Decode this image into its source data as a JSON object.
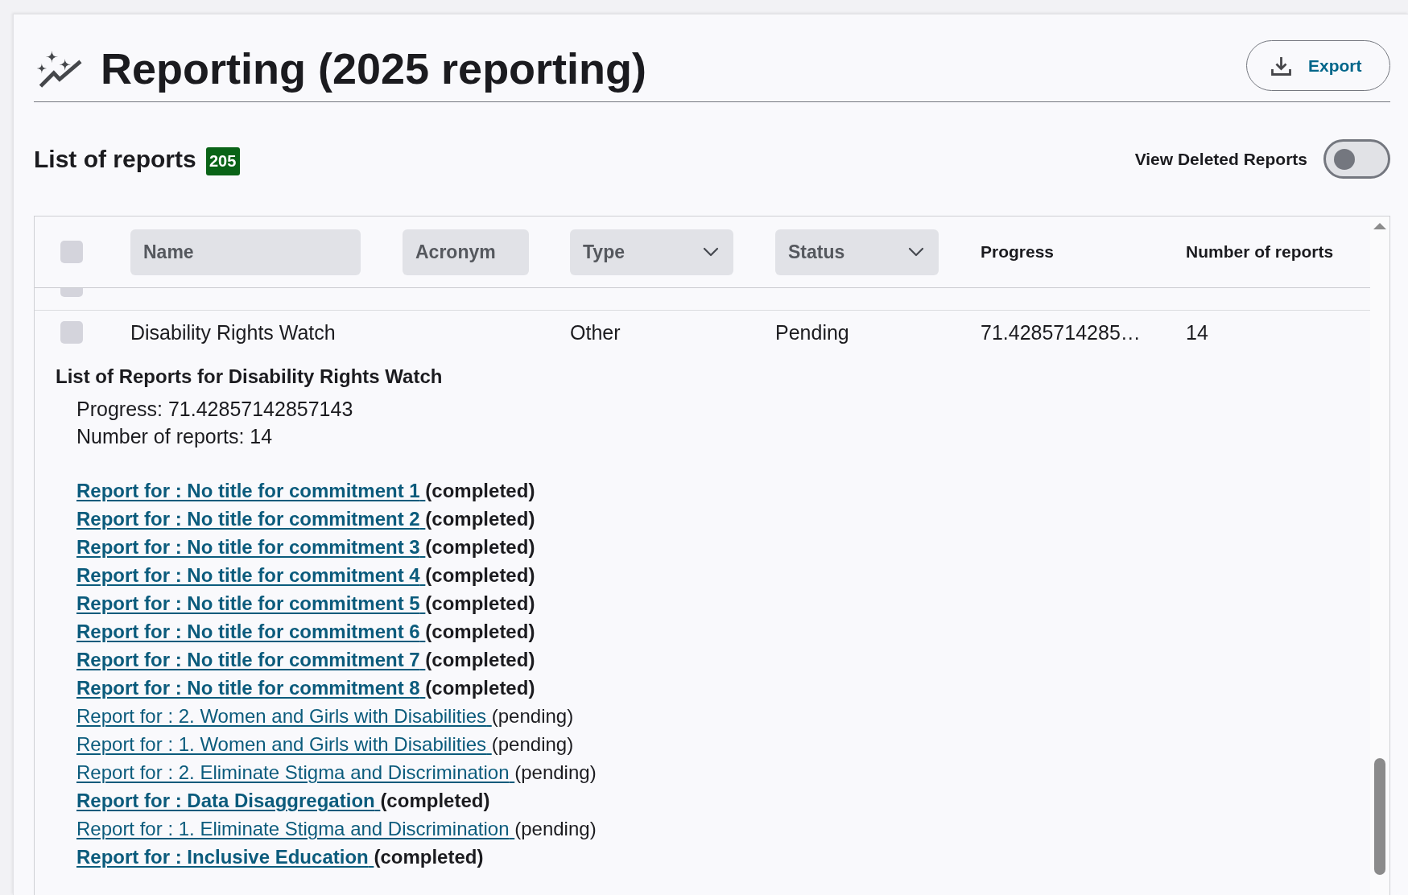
{
  "page": {
    "title": "Reporting (2025 reporting)",
    "export_button": "Export"
  },
  "list_header": {
    "title": "List of reports",
    "count": "205",
    "toggle": {
      "label": "View Deleted Reports",
      "on": false
    }
  },
  "table": {
    "select_all": {
      "checked": false
    },
    "columns": [
      {
        "kind": "text",
        "placeholder": "Name"
      },
      {
        "kind": "text",
        "placeholder": "Acronym"
      },
      {
        "kind": "select",
        "label": "Type"
      },
      {
        "kind": "select",
        "label": "Status"
      },
      {
        "kind": "plain",
        "label": "Progress"
      },
      {
        "kind": "plain",
        "label": "Number of reports"
      }
    ],
    "rows": [
      {
        "checked": false,
        "partly_hidden": true,
        "expanded": false
      },
      {
        "checked": false,
        "partly_hidden": false,
        "expanded": true,
        "name": "Disability Rights Watch",
        "type": "Other",
        "status": "Pending",
        "progress": "71.4285714285…",
        "number_of_reports": "14",
        "details": {
          "title": "List of Reports for Disability Rights Watch",
          "progress": "Progress: 71.42857142857143",
          "count": "Number of reports: 14",
          "reports": [
            {
              "link": "Report for : No title for commitment 1",
              "status": "(completed)",
              "completed": true
            },
            {
              "link": "Report for : No title for commitment 2",
              "status": "(completed)",
              "completed": true
            },
            {
              "link": "Report for : No title for commitment 3",
              "status": "(completed)",
              "completed": true
            },
            {
              "link": "Report for : No title for commitment 4",
              "status": "(completed)",
              "completed": true
            },
            {
              "link": "Report for : No title for commitment 5",
              "status": "(completed)",
              "completed": true
            },
            {
              "link": "Report for : No title for commitment 6",
              "status": "(completed)",
              "completed": true
            },
            {
              "link": "Report for : No title for commitment 7",
              "status": "(completed)",
              "completed": true
            },
            {
              "link": "Report for : No title for commitment 8",
              "status": "(completed)",
              "completed": true
            },
            {
              "link": "Report for : 2. Women and Girls with Disabilities",
              "status": "(pending)",
              "completed": false
            },
            {
              "link": "Report for : 1. Women and Girls with Disabilities",
              "status": "(pending)",
              "completed": false
            },
            {
              "link": "Report for : 2. Eliminate Stigma and Discrimination",
              "status": "(pending)",
              "completed": false
            },
            {
              "link": "Report for : Data Disaggregation",
              "status": "(completed)",
              "completed": true
            },
            {
              "link": "Report for : 1. Eliminate Stigma and Discrimination",
              "status": "(pending)",
              "completed": false
            },
            {
              "link": "Report for : Inclusive Education",
              "status": "(completed)",
              "completed": true
            }
          ]
        }
      }
    ]
  }
}
